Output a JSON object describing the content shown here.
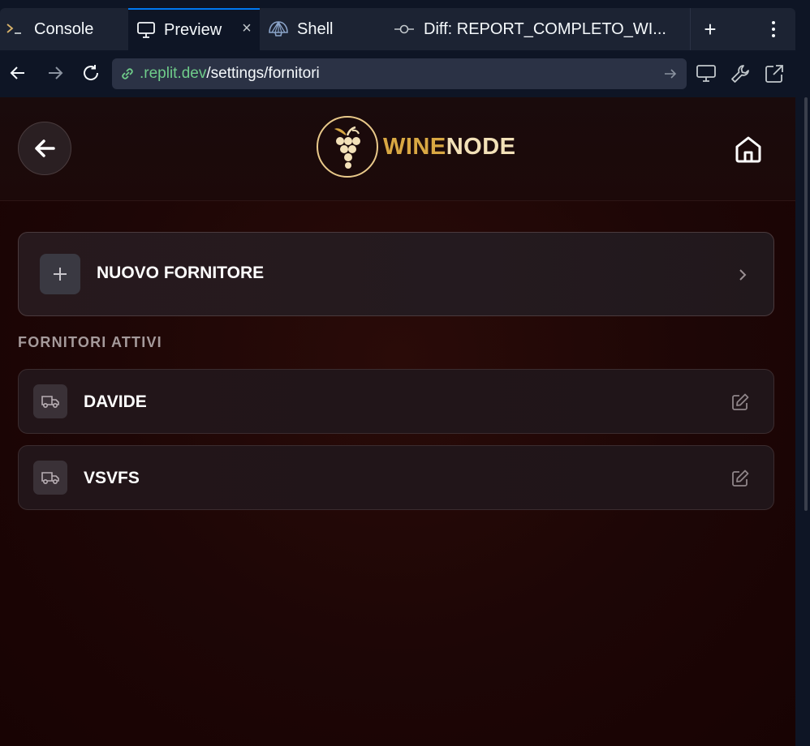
{
  "browser": {
    "tabs": [
      {
        "label": "Console",
        "icon": "terminal-icon"
      },
      {
        "label": "Preview",
        "icon": "monitor-icon",
        "active": true
      },
      {
        "label": "Shell",
        "icon": "shell-icon"
      },
      {
        "label": "Diff: REPORT_COMPLETO_WI...",
        "icon": "commit-icon"
      }
    ],
    "close_tab": "×",
    "add_tab": "+",
    "url_host": ".replit.dev",
    "url_path": "/settings/fornitori",
    "accent": "#0079f2"
  },
  "app": {
    "brand_part1": "WINE",
    "brand_part2": "NODE",
    "new_supplier_label": "NUOVO FORNITORE",
    "section_title": "FORNITORI ATTIVI",
    "suppliers": [
      {
        "name": "DAVIDE"
      },
      {
        "name": "VSVFS"
      }
    ],
    "colors": {
      "brand_gold": "#d9a843",
      "brand_light": "#f3e1b8",
      "background": "#1d0606"
    }
  }
}
